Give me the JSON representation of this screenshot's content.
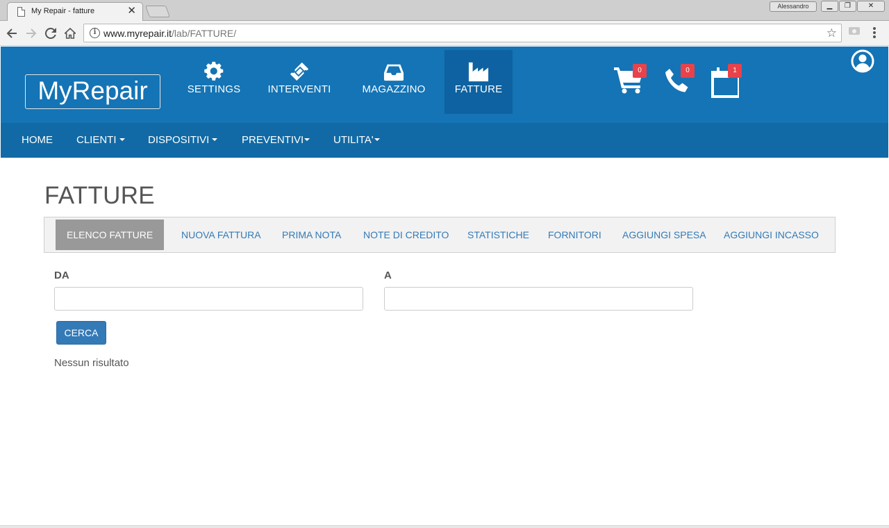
{
  "browser": {
    "tab_title": "My Repair - fatture",
    "tab_close": "✕",
    "profile_name": "Alessandro",
    "url_host": "www.myrepair.it",
    "url_path": "/lab/FATTURE/"
  },
  "header": {
    "logo": "MyRepair",
    "modules": [
      {
        "label": "SETTINGS",
        "icon": "gear-icon"
      },
      {
        "label": "INTERVENTI",
        "icon": "ticket-icon"
      },
      {
        "label": "MAGAZZINO",
        "icon": "inbox-icon"
      },
      {
        "label": "FATTURE",
        "icon": "factory-icon",
        "active": true
      }
    ],
    "shortcuts": {
      "cart_count": "0",
      "phone_count": "0",
      "calendar_count": "1"
    }
  },
  "subnav": {
    "items": [
      {
        "label": "HOME"
      },
      {
        "label": "CLIENTI",
        "dropdown": true
      },
      {
        "label": "DISPOSITIVI",
        "dropdown": true
      },
      {
        "label": "PREVENTIVI",
        "dropdown": true
      },
      {
        "label": "UTILITA'",
        "dropdown": true
      }
    ]
  },
  "page": {
    "title": "FATTURE",
    "tabs": [
      {
        "label": "ELENCO FATTURE",
        "active": true
      },
      {
        "label": "NUOVA FATTURA"
      },
      {
        "label": "PRIMA NOTA"
      },
      {
        "label": "NOTE DI CREDITO"
      },
      {
        "label": "STATISTICHE"
      },
      {
        "label": "FORNITORI"
      },
      {
        "label": "AGGIUNGI SPESA"
      },
      {
        "label": "AGGIUNGI INCASSO"
      }
    ],
    "form": {
      "from_label": "DA",
      "from_value": "",
      "to_label": "A",
      "to_value": "",
      "search_label": "CERCA"
    },
    "result_text": "Nessun risultato"
  },
  "colors": {
    "header": "#1474b5",
    "subnav": "#116aa5",
    "active_module": "#0e62a1",
    "badge": "#e8424a",
    "primary_button": "#337ab7"
  }
}
